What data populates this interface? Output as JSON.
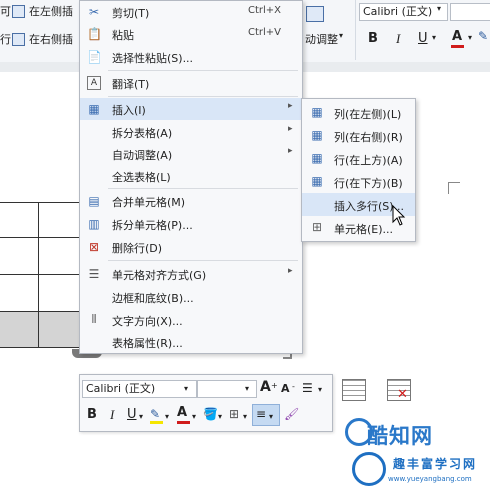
{
  "ribbon": {
    "row1_cut": "可",
    "insert_left_label": "在左侧插",
    "row2_cut": "行",
    "insert_right_label": "在右侧插",
    "autofit_label": "动调整",
    "font_name": "Calibri (正文)",
    "bold": "B",
    "italic": "I",
    "underline": "U",
    "font_color": "A"
  },
  "context_menu": {
    "items": [
      {
        "label": "剪切(T)",
        "shortcut": "Ctrl+X",
        "icon": "scissors-icon"
      },
      {
        "label": "粘贴",
        "shortcut": "Ctrl+V",
        "icon": "paste-icon"
      },
      {
        "label": "选择性粘贴(S)...",
        "shortcut": "",
        "icon": "paste-special-icon"
      },
      {
        "label": "翻译(T)",
        "shortcut": "",
        "icon": "translate-icon"
      },
      {
        "label": "插入(I)",
        "shortcut": "",
        "icon": "table-insert-icon",
        "submenu": true,
        "highlighted": true
      },
      {
        "label": "拆分表格(A)",
        "shortcut": "",
        "icon": "",
        "submenu": true
      },
      {
        "label": "自动调整(A)",
        "shortcut": "",
        "icon": "",
        "submenu": true
      },
      {
        "label": "全选表格(L)",
        "shortcut": "",
        "icon": ""
      },
      {
        "label": "合并单元格(M)",
        "shortcut": "",
        "icon": "merge-cells-icon"
      },
      {
        "label": "拆分单元格(P)...",
        "shortcut": "",
        "icon": "split-cells-icon"
      },
      {
        "label": "删除行(D)",
        "shortcut": "",
        "icon": "delete-row-icon"
      },
      {
        "label": "单元格对齐方式(G)",
        "shortcut": "",
        "icon": "cell-align-icon",
        "submenu": true
      },
      {
        "label": "边框和底纹(B)...",
        "shortcut": "",
        "icon": ""
      },
      {
        "label": "文字方向(X)...",
        "shortcut": "",
        "icon": "text-direction-icon"
      },
      {
        "label": "表格属性(R)...",
        "shortcut": "",
        "icon": ""
      }
    ]
  },
  "insert_submenu": {
    "items": [
      {
        "label": "列(在左侧)(L)",
        "icon": "insert-col-left-icon"
      },
      {
        "label": "列(在右侧)(R)",
        "icon": "insert-col-right-icon"
      },
      {
        "label": "行(在上方)(A)",
        "icon": "insert-row-above-icon"
      },
      {
        "label": "行(在下方)(B)",
        "icon": "insert-row-below-icon"
      },
      {
        "label": "插入多行(S)...",
        "icon": "",
        "highlighted": true
      },
      {
        "label": "单元格(E)...",
        "icon": "insert-cells-icon"
      }
    ]
  },
  "mini_toolbar": {
    "font_name": "Calibri (正文)",
    "font_size": "",
    "grow_font": "A",
    "shrink_font": "A",
    "bold": "B",
    "italic": "I",
    "underline": "U",
    "font_color": "A"
  },
  "watermark": {
    "brand": "酷知网",
    "brand2": "趣丰富学习网",
    "url": "www.yueyangbang.com"
  },
  "colors": {
    "menu_highlight": "#d9e6f7",
    "font_color_bar": "#d01c1c",
    "highlight_bar": "#f5e600",
    "watermark_blue": "#2a78c9"
  }
}
